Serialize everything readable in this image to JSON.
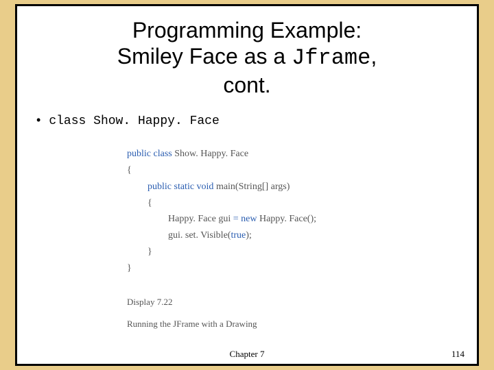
{
  "title": {
    "line1": "Programming Example:",
    "line2_pre": "Smiley Face as a ",
    "line2_mono": "Jframe",
    "line2_post": ",",
    "line3": "cont."
  },
  "bullet": {
    "dot": "•",
    "prefix": "class",
    "name": "Show. Happy. Face"
  },
  "code": {
    "kw_public": "public",
    "kw_class": "class",
    "classname": "Show. Happy. Face",
    "brace_open": "{",
    "kw_static": "static",
    "kw_void": "void",
    "main_sig": "main(String[] args)",
    "line_decl_pre": "Happy. Face gui ",
    "kw_eq_new": "= new",
    "line_decl_post": " Happy. Face();",
    "line_visible_pre": "gui. set. Visible(",
    "kw_true": "true",
    "line_visible_post": ");",
    "brace_close": "}"
  },
  "caption": {
    "display": "Display 7.22",
    "running": "Running the JFrame with a Drawing"
  },
  "footer": {
    "chapter": "Chapter 7",
    "page": "114"
  }
}
